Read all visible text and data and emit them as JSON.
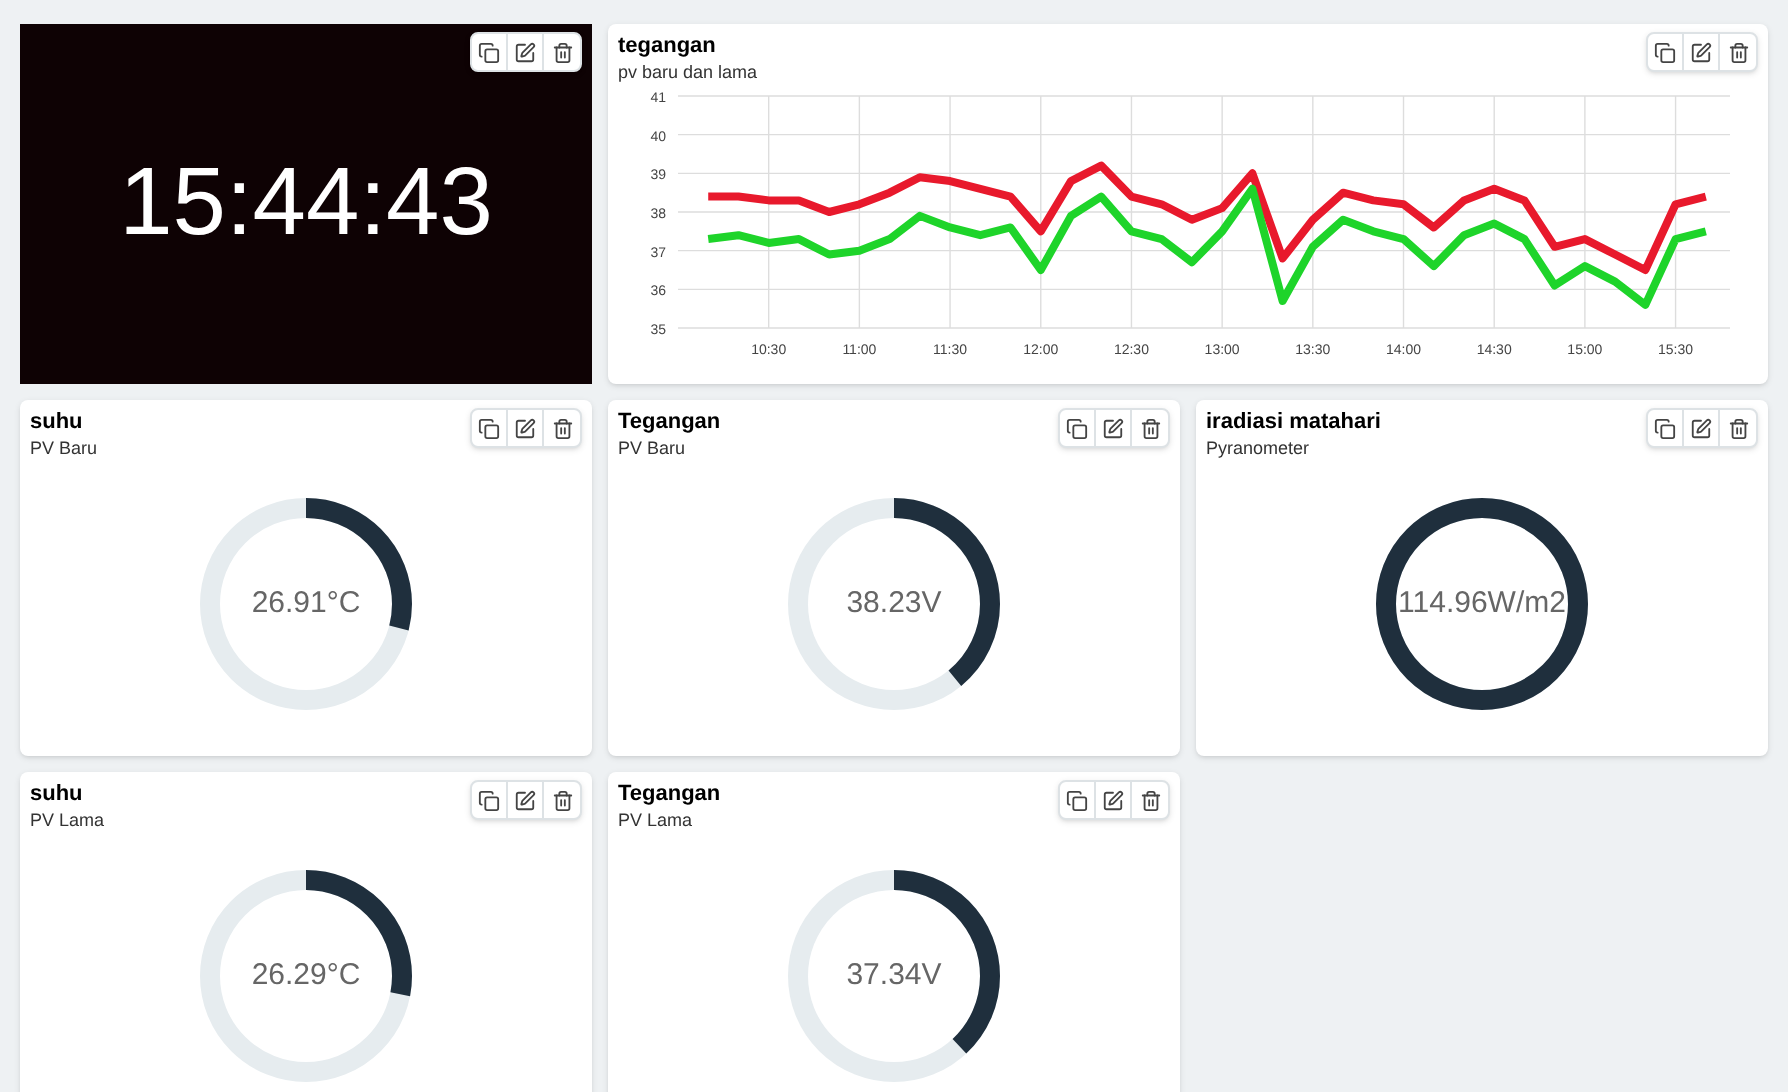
{
  "clock": {
    "time": "15:44:43"
  },
  "chart_widget": {
    "title": "tegangan",
    "subtitle": "pv baru dan lama",
    "chart_data": {
      "type": "line",
      "grid": true,
      "x": [
        610,
        620,
        630,
        640,
        650,
        660,
        670,
        680,
        690,
        700,
        710,
        720,
        730,
        740,
        750,
        760,
        770,
        780,
        790,
        800,
        810,
        820,
        830,
        840,
        850,
        860,
        870,
        880,
        890,
        900,
        910,
        920,
        930,
        940
      ],
      "xlim": [
        600,
        948
      ],
      "series": [
        {
          "color": "#e8192c",
          "values": [
            38.4,
            38.4,
            38.3,
            38.3,
            38.0,
            38.2,
            38.5,
            38.9,
            38.8,
            38.6,
            38.4,
            37.5,
            38.8,
            39.2,
            38.4,
            38.2,
            37.8,
            38.1,
            39.0,
            36.8,
            37.8,
            38.5,
            38.3,
            38.2,
            37.6,
            38.3,
            38.6,
            38.3,
            37.1,
            37.3,
            36.9,
            36.5,
            38.2,
            38.4
          ]
        },
        {
          "color": "#1ed42a",
          "values": [
            37.3,
            37.4,
            37.2,
            37.3,
            36.9,
            37.0,
            37.3,
            37.9,
            37.6,
            37.4,
            37.6,
            36.5,
            37.9,
            38.4,
            37.5,
            37.3,
            36.7,
            37.5,
            38.6,
            35.7,
            37.1,
            37.8,
            37.5,
            37.3,
            36.6,
            37.4,
            37.7,
            37.3,
            36.1,
            36.6,
            36.2,
            35.6,
            37.3,
            37.5
          ]
        }
      ],
      "ylim": [
        35,
        41
      ],
      "yticks": [
        35,
        36,
        37,
        38,
        39,
        40,
        41
      ],
      "xticks": [
        {
          "value": 630,
          "label": "10:30"
        },
        {
          "value": 660,
          "label": "11:00"
        },
        {
          "value": 690,
          "label": "11:30"
        },
        {
          "value": 720,
          "label": "12:00"
        },
        {
          "value": 750,
          "label": "12:30"
        },
        {
          "value": 780,
          "label": "13:00"
        },
        {
          "value": 810,
          "label": "13:30"
        },
        {
          "value": 840,
          "label": "14:00"
        },
        {
          "value": 870,
          "label": "14:30"
        },
        {
          "value": 900,
          "label": "15:00"
        },
        {
          "value": 930,
          "label": "15:30"
        }
      ]
    }
  },
  "gauges": [
    {
      "title": "suhu",
      "subtitle": "PV Baru",
      "reading": "26.91°C",
      "level": 0.29
    },
    {
      "title": "Tegangan",
      "subtitle": "PV Baru",
      "reading": "38.23V",
      "level": 0.39
    },
    {
      "title": "iradiasi matahari",
      "subtitle": "Pyranometer",
      "reading": "114.96W/m2",
      "level": 1
    },
    {
      "title": "suhu",
      "subtitle": "PV Lama",
      "reading": "26.29°C",
      "level": 0.28
    },
    {
      "title": "Tegangan",
      "subtitle": "PV Lama",
      "reading": "37.34V",
      "level": 0.38
    }
  ]
}
